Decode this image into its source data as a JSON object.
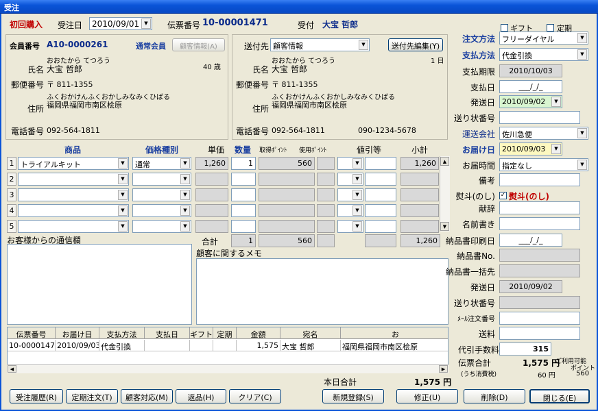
{
  "window": {
    "title": "受注"
  },
  "header": {
    "first_purchase": "初回購入",
    "order_date_label": "受注日",
    "order_date": "2010/09/01",
    "slip_no_label": "伝票番号",
    "slip_no": "10-00001471",
    "reception_label": "受付",
    "reception_name": "大宝 哲郎"
  },
  "customer": {
    "member_no_label": "会員番号",
    "member_no": "A10-0000261",
    "member_type": "通常会員",
    "info_button": "顧客情報(A)",
    "name_kana": "おおたから てつろう",
    "name_label": "氏名",
    "name": "大宝 哲郎",
    "age": "40 歳",
    "postal_label": "郵便番号",
    "postal": "〒 811-1355",
    "address_label": "住所",
    "address_kana": "ふくおかけんふくおかしみなみくひばる",
    "address": "福岡県福岡市南区桧原",
    "phone_label": "電話番号",
    "phone": "092-564-1811"
  },
  "shipping": {
    "dest_label": "送付先",
    "dest_select": "顧客情報",
    "edit_button": "送付先編集(Y)",
    "name_kana": "おおたから てつろう",
    "count": "1 日",
    "name_label": "氏名",
    "name": "大宝 哲郎",
    "postal_label": "郵便番号",
    "postal": "〒 811-1355",
    "address_label": "住所",
    "address_kana": "ふくおかけんふくおかしみなみくひばる",
    "address": "福岡県福岡市南区桧原",
    "phone_label": "電話番号",
    "phone": "092-564-1811",
    "phone2": "090-1234-5678"
  },
  "items": {
    "headers": {
      "product": "商品",
      "price_type": "価格種別",
      "unit_price": "単価",
      "qty": "数量",
      "points_earned": "取得ﾎﾟｲﾝﾄ",
      "points_used": "使用ﾎﾟｲﾝﾄ",
      "discount": "値引等",
      "subtotal": "小計"
    },
    "rows": [
      {
        "no": "1",
        "product": "トライアルキット",
        "price_type": "通常",
        "unit_price": "1,260",
        "qty": "1",
        "points": "560",
        "subtotal": "1,260"
      },
      {
        "no": "2",
        "product": "",
        "price_type": "",
        "unit_price": "",
        "qty": "",
        "points": "",
        "subtotal": ""
      },
      {
        "no": "3",
        "product": "",
        "price_type": "",
        "unit_price": "",
        "qty": "",
        "points": "",
        "subtotal": ""
      },
      {
        "no": "4",
        "product": "",
        "price_type": "",
        "unit_price": "",
        "qty": "",
        "points": "",
        "subtotal": ""
      },
      {
        "no": "5",
        "product": "",
        "price_type": "",
        "unit_price": "",
        "qty": "",
        "points": "",
        "subtotal": ""
      }
    ],
    "total_label": "合計",
    "total_qty": "1",
    "total_points": "560",
    "total_amount": "1,260"
  },
  "messages": {
    "from_customer_label": "お客様からの通信欄",
    "customer_memo_label": "顧客に関するメモ"
  },
  "history": {
    "headers": [
      "伝票番号",
      "お届け日",
      "支払方法",
      "支払日",
      "ギフト",
      "定期",
      "金額",
      "宛名",
      "お"
    ],
    "rows": [
      [
        "10-00001471",
        "2010/09/03",
        "代金引換",
        "",
        "",
        "",
        "1,575",
        "大宝 哲郎",
        "福岡県福岡市南区桧原"
      ]
    ]
  },
  "today_total_label": "本日合計",
  "today_total": "1,575 円",
  "right": {
    "gift_label": "ギフト",
    "regular_label": "定期",
    "order_method_label": "注文方法",
    "order_method": "フリーダイヤル",
    "payment_method_label": "支払方法",
    "payment_method": "代金引換",
    "payment_due_label": "支払期限",
    "payment_due": "2010/10/03",
    "payment_date_label": "支払日",
    "payment_date": "___/_/_",
    "ship_date_label": "発送日",
    "ship_date": "2010/09/02",
    "tracking_label": "送り状番号",
    "carrier_label": "運送会社",
    "carrier": "佐川急便",
    "delivery_date_label": "お届け日",
    "delivery_date": "2010/09/03",
    "delivery_time_label": "お届時間",
    "delivery_time": "指定なし",
    "remarks_label": "備考",
    "noshi_label": "熨斗(のし)",
    "noshi_check_label": "熨斗(のし)",
    "gift_words_label": "献辞",
    "name_writing_label": "名前書き",
    "invoice_print_label": "納品書印刷日",
    "invoice_print": "___/_/_",
    "invoice_no_label": "納品書No.",
    "invoice_batch_label": "納品書一括先",
    "ship_date2_label": "発送日",
    "ship_date2": "2010/09/02",
    "tracking2_label": "送り状番号",
    "mail_order_label": "ﾒｰﾙ注文番号",
    "shipping_fee_label": "送料",
    "cod_fee_label": "代引手数料",
    "cod_fee": "315",
    "slip_total_label": "伝票合計",
    "slip_total": "1,575 円",
    "tax_label": "(うち消費税)",
    "tax": "60 円",
    "points_label_1": "ご利用可能",
    "points_label_2": "ポイント",
    "points": "560"
  },
  "footer": {
    "history_btn": "受注履歴(R)",
    "regular_btn": "定期注文(T)",
    "support_btn": "顧客対応(M)",
    "return_btn": "返品(H)",
    "clear_btn": "クリア(C)",
    "new_btn": "新規登録(S)",
    "edit_btn": "修正(U)",
    "delete_btn": "削除(D)",
    "close_btn": "閉じる(E)"
  }
}
